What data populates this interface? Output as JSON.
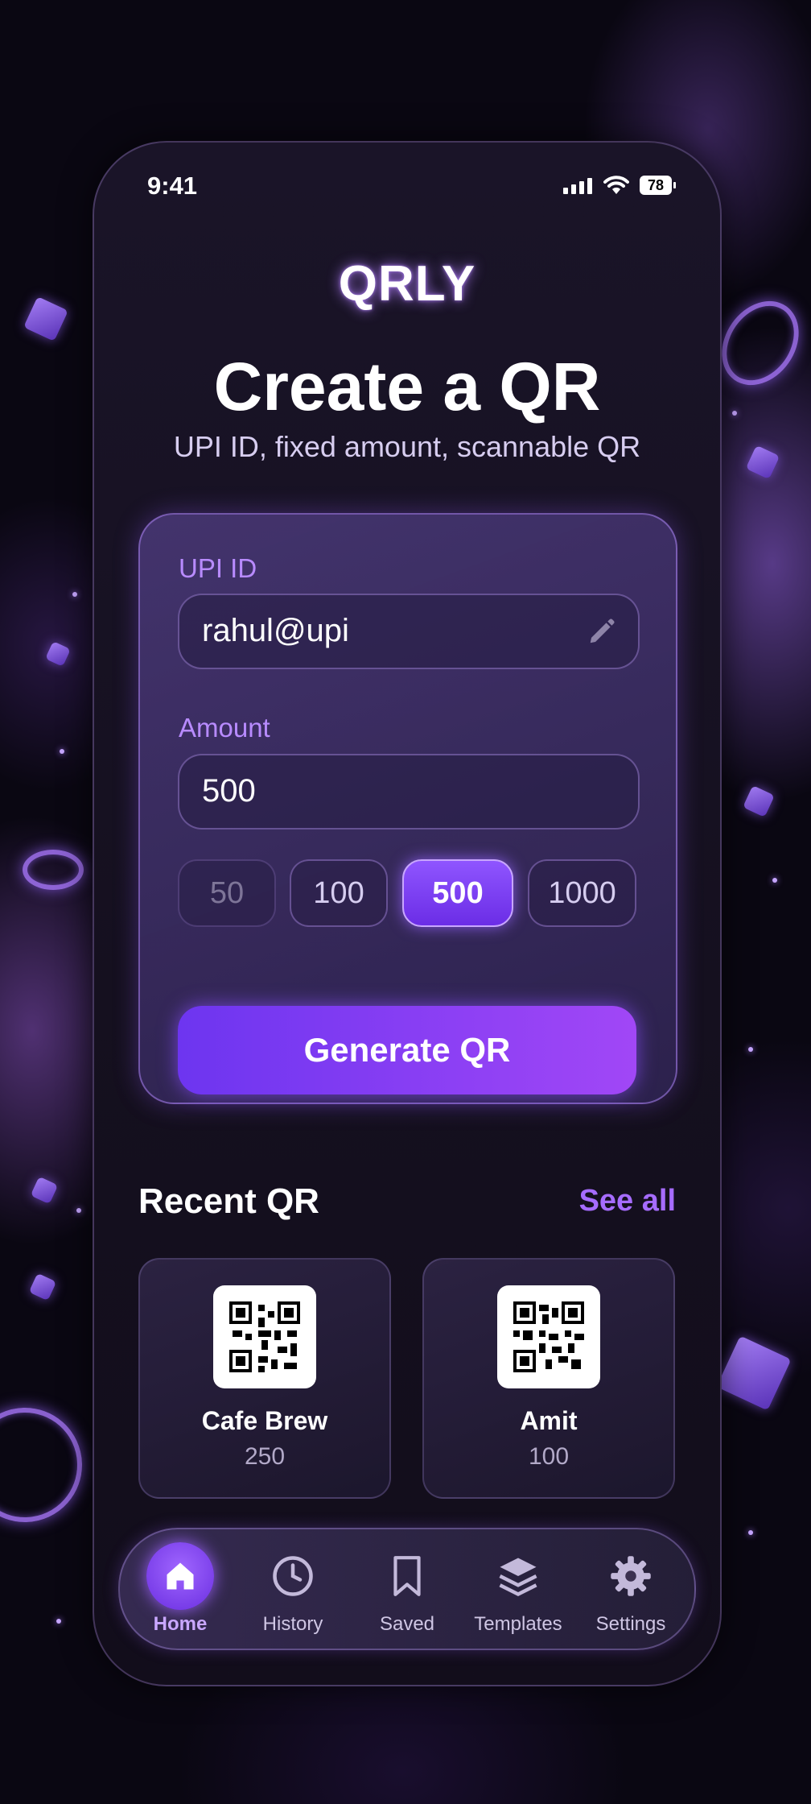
{
  "status_bar": {
    "time": "9:41",
    "battery": "78"
  },
  "app": {
    "logo": "QRLY",
    "title": "Create a QR",
    "subtitle": "UPI ID, fixed amount, scannable QR"
  },
  "form": {
    "upi_label": "UPI ID",
    "upi_value": "rahul@upi",
    "amount_label": "Amount",
    "amount_value": "500",
    "presets": [
      "50",
      "100",
      "500",
      "1000"
    ],
    "selected_preset": "500",
    "generate_label": "Generate QR"
  },
  "recent": {
    "title": "Recent QR",
    "see_all": "See all",
    "items": [
      {
        "name": "Cafe Brew",
        "amount": "250"
      },
      {
        "name": "Amit",
        "amount": "100"
      }
    ]
  },
  "nav": {
    "items": [
      {
        "label": "Home",
        "icon": "home-icon",
        "active": true
      },
      {
        "label": "History",
        "icon": "clock-icon",
        "active": false
      },
      {
        "label": "Saved",
        "icon": "bookmark-icon",
        "active": false
      },
      {
        "label": "Templates",
        "icon": "layers-icon",
        "active": false
      },
      {
        "label": "Settings",
        "icon": "gear-icon",
        "active": false
      }
    ]
  },
  "colors": {
    "accent": "#8f55ff",
    "accent_text": "#b88bff",
    "background": "#0a0712"
  }
}
